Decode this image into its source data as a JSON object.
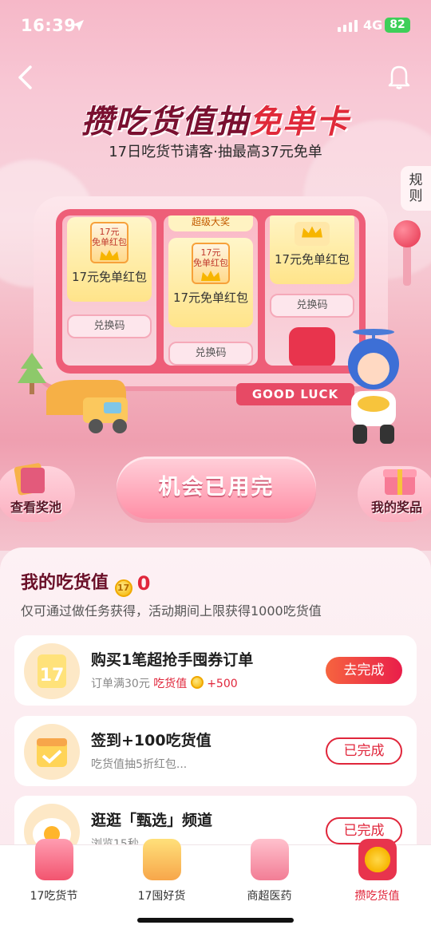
{
  "status": {
    "time": "16:39",
    "network": "4G",
    "battery": "82"
  },
  "hero": {
    "title_a": "攒吃货值抽",
    "title_b": "免单卡",
    "subtitle": "17日吃货节请客·抽最高37元免单",
    "rules": [
      "规",
      "则"
    ],
    "reels": [
      {
        "ticket_amount": "17元",
        "ticket_type": "免单红包",
        "label": "17元免单红包",
        "code": "兑换码"
      },
      {
        "top_hint": "超级大奖",
        "ticket_amount": "17元",
        "ticket_type": "免单红包",
        "label": "17元免单红包",
        "code": "兑换码"
      },
      {
        "label": "17元免单红包",
        "code": "兑换码"
      }
    ],
    "good_luck": "GOOD LUCK",
    "main_button": "机会已用完",
    "left_button": "查看奖池",
    "right_button": "我的奖品"
  },
  "panel": {
    "title": "我的吃货值",
    "coin_label": "17",
    "value": "0",
    "desc": "仅可通过做任务获得，活动期间上限获得1000吃货值"
  },
  "tasks": [
    {
      "title": "购买1笔超抢手囤券订单",
      "desc": "订单满30元",
      "highlight": "吃货值",
      "bonus": "+500",
      "button": "去完成",
      "icon_text": "17"
    },
    {
      "title": "签到+100吃货值",
      "desc": "吃货值抽5折红包...",
      "button": "已完成"
    },
    {
      "title": "逛逛「甄选」频道",
      "desc": "浏览15秒",
      "button": "已完成"
    }
  ],
  "tabs": [
    {
      "label": "17吃货节",
      "active": false
    },
    {
      "label": "17囤好货",
      "active": false
    },
    {
      "label": "商超医药",
      "active": false
    },
    {
      "label": "攒吃货值",
      "active": true
    }
  ],
  "colors": {
    "accent": "#e0263b",
    "brand_dark": "#6a0f28",
    "pink": "#f7b4c3"
  },
  "icons": [
    "location-arrow-icon",
    "back-icon",
    "bell-icon",
    "crown-icon",
    "coin-icon",
    "calendar-icon",
    "gift-icon",
    "egg-icon"
  ]
}
